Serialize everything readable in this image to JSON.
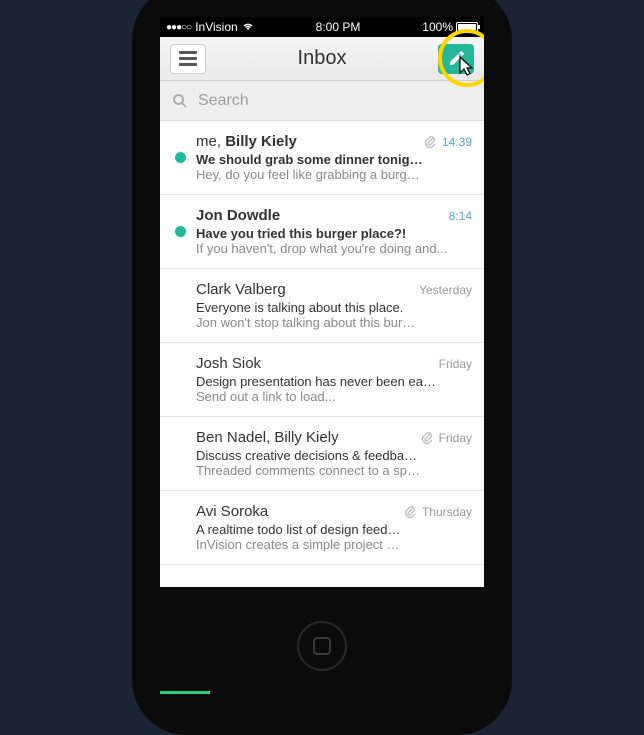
{
  "statusbar": {
    "signal_dots": "●●●○○",
    "carrier": "InVision",
    "time": "8:00 PM",
    "battery_pct": "100%"
  },
  "navbar": {
    "title": "Inbox"
  },
  "search": {
    "placeholder": "Search"
  },
  "messages": [
    {
      "unread": true,
      "sender_pre": "me, ",
      "sender_bold": "Billy Kiely",
      "subject": "We should grab some dinner tonight.",
      "subject_bold": true,
      "preview": "Hey, do you feel like grabbing a burger aft...",
      "preview2": "",
      "time": "14:39",
      "attachment": true,
      "time_highlight": true
    },
    {
      "unread": true,
      "sender_pre": "",
      "sender_bold": "Jon Dowdle",
      "subject": "Have you tried this burger place?!",
      "subject_bold": true,
      "preview": "If you haven't, drop what you're doing and...",
      "preview2": "",
      "time": "8:14",
      "attachment": false,
      "time_highlight": true
    },
    {
      "unread": false,
      "sender_pre": "Clark Valberg",
      "sender_bold": "",
      "subject": "Everyone is talking about this place.",
      "subject_bold": false,
      "preview": "Jon won't stop talking about this burger pl...",
      "preview2": "",
      "time": "Yesterday",
      "attachment": false,
      "time_highlight": false
    },
    {
      "unread": false,
      "sender_pre": "Josh Siok",
      "sender_bold": "",
      "subject": "Design presentation has never been eas...",
      "subject_bold": false,
      "preview": "Send out a link to load...",
      "preview2": "",
      "time": "Friday",
      "attachment": false,
      "time_highlight": false
    },
    {
      "unread": false,
      "sender_pre": "Ben Nadel, Billy Kiely",
      "sender_bold": "",
      "subject": "Discuss creative decisions & feedback...",
      "subject_bold": false,
      "preview": "Threaded comments connect to a specifi...",
      "preview2": "",
      "time": "Friday",
      "attachment": true,
      "time_highlight": false
    },
    {
      "unread": false,
      "sender_pre": "Avi Soroka",
      "sender_bold": "",
      "subject": "A realtime todo list of design feedback...",
      "subject_bold": false,
      "preview": "InVision creates a simple project checklist...",
      "preview2": "",
      "time": "Thursday",
      "attachment": true,
      "time_highlight": false
    }
  ]
}
